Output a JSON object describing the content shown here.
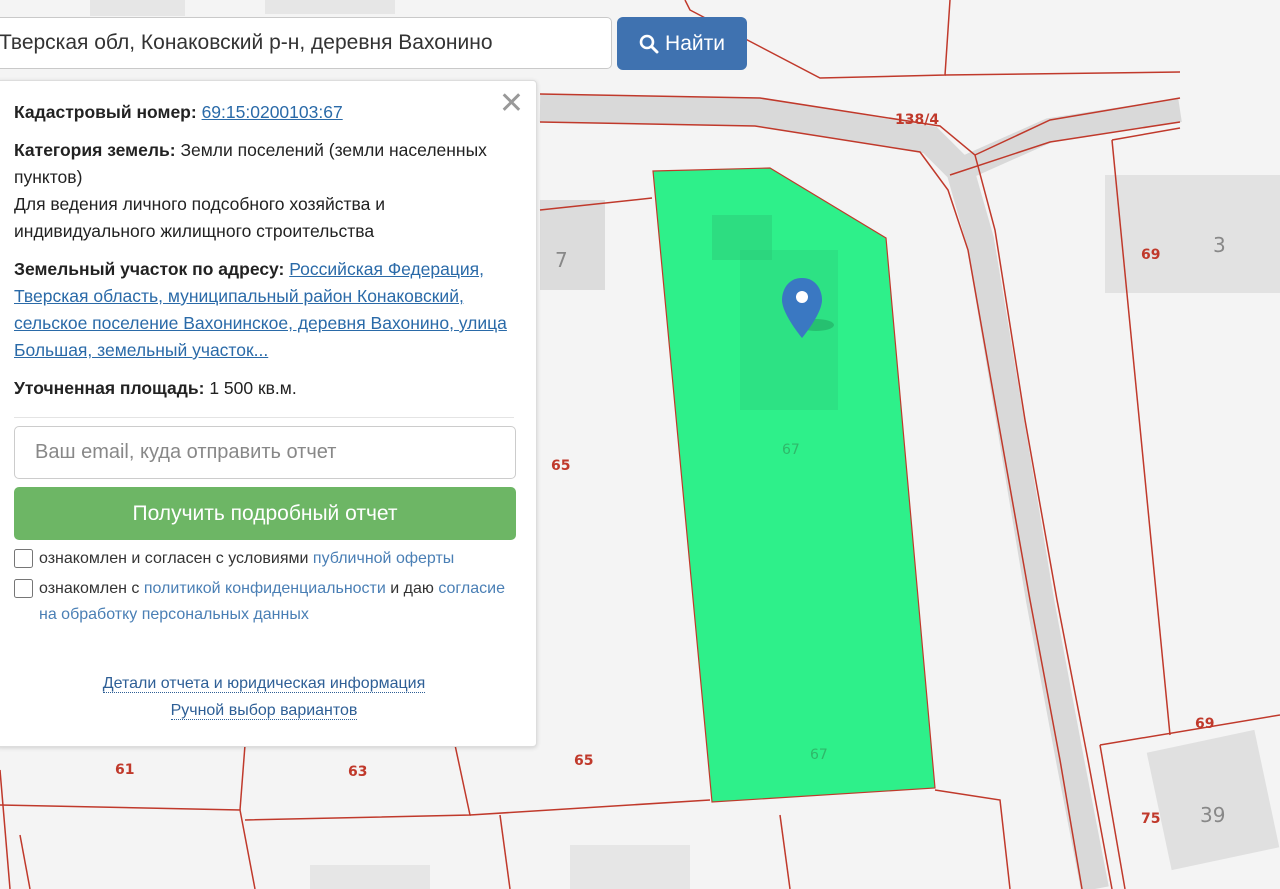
{
  "search": {
    "value": "Тверская обл, Конаковский р-н, деревня Вахонино",
    "button_label": "Найти"
  },
  "panel": {
    "cadastral_label": "Кадастровый номер:",
    "cadastral_number": "69:15:0200103:67",
    "category_label": "Категория земель:",
    "category_value": "Земли поселений (земли населенных пунктов)",
    "usage_value": "Для ведения личного подсобного хозяйства и индивидуального жилищного строительства",
    "address_label": "Земельный участок по адресу:",
    "address_value": "Российская Федерация, Тверская область, муниципальный район Конаковский, сельское поселение Вахонинское, деревня Вахонино, улица Большая, земельный участок...",
    "area_label": "Уточненная площадь:",
    "area_value": "1 500 кв.м.",
    "email_placeholder": "Ваш email, куда отправить отчет",
    "report_button": "Получить подробный отчет",
    "consent1_text": "ознакомлен и согласен с условиями",
    "consent1_link": "публичной оферты",
    "consent2_prefix": "ознакомлен с",
    "consent2_link1": "политикой конфиденциальности",
    "consent2_mid": "и даю",
    "consent2_link2": "согласие на обработку персональных данных",
    "details_link": "Детали отчета и юридическая информация",
    "manual_link": "Ручной выбор вариантов"
  },
  "map": {
    "road_label": "138/4",
    "plot_numbers": [
      "7",
      "65",
      "65",
      "61",
      "63",
      "69",
      "69",
      "75"
    ],
    "plot_label_main": "67",
    "house_numbers": [
      "3",
      "39"
    ],
    "highlight_color": "#2ef08a",
    "boundary_color": "#c0392b"
  }
}
